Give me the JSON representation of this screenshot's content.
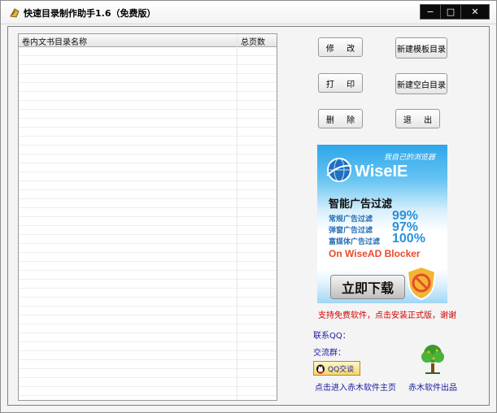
{
  "window": {
    "title": "快速目录制作助手1.6（免费版）",
    "buttons": {
      "minimize": "−",
      "maximize": "□",
      "close": "✕"
    }
  },
  "list": {
    "columns": [
      "卷内文书目录名称",
      "总页数"
    ],
    "rows": []
  },
  "actions": {
    "modify": "修 改",
    "print": "打 印",
    "delete": "删 除",
    "new_template": "新建模板目录",
    "new_blank": "新建空白目录",
    "exit": "退 出"
  },
  "ad": {
    "slogan": "我自己的浏览器",
    "brand": "WiseIE",
    "headline": "智能广告过滤",
    "stats": [
      {
        "label": "常规广告过滤",
        "value": "99%"
      },
      {
        "label": "弹窗广告过滤",
        "value": "97%"
      },
      {
        "label": "富媒体广告过滤",
        "value": "100%"
      }
    ],
    "blocker": "On WiseAD Blocker",
    "download": "立即下载",
    "colors": {
      "blue": "#2ea6ea",
      "red": "#e84b2c"
    }
  },
  "footer": {
    "support": "支持免费软件，点击安装正式版，谢谢",
    "contact_qq": "联系QQ：",
    "group": "交流群：",
    "qq_chat": "QQ交谈",
    "homepage": "点击进入赤木软件主页",
    "maker": "赤木软件出品"
  }
}
